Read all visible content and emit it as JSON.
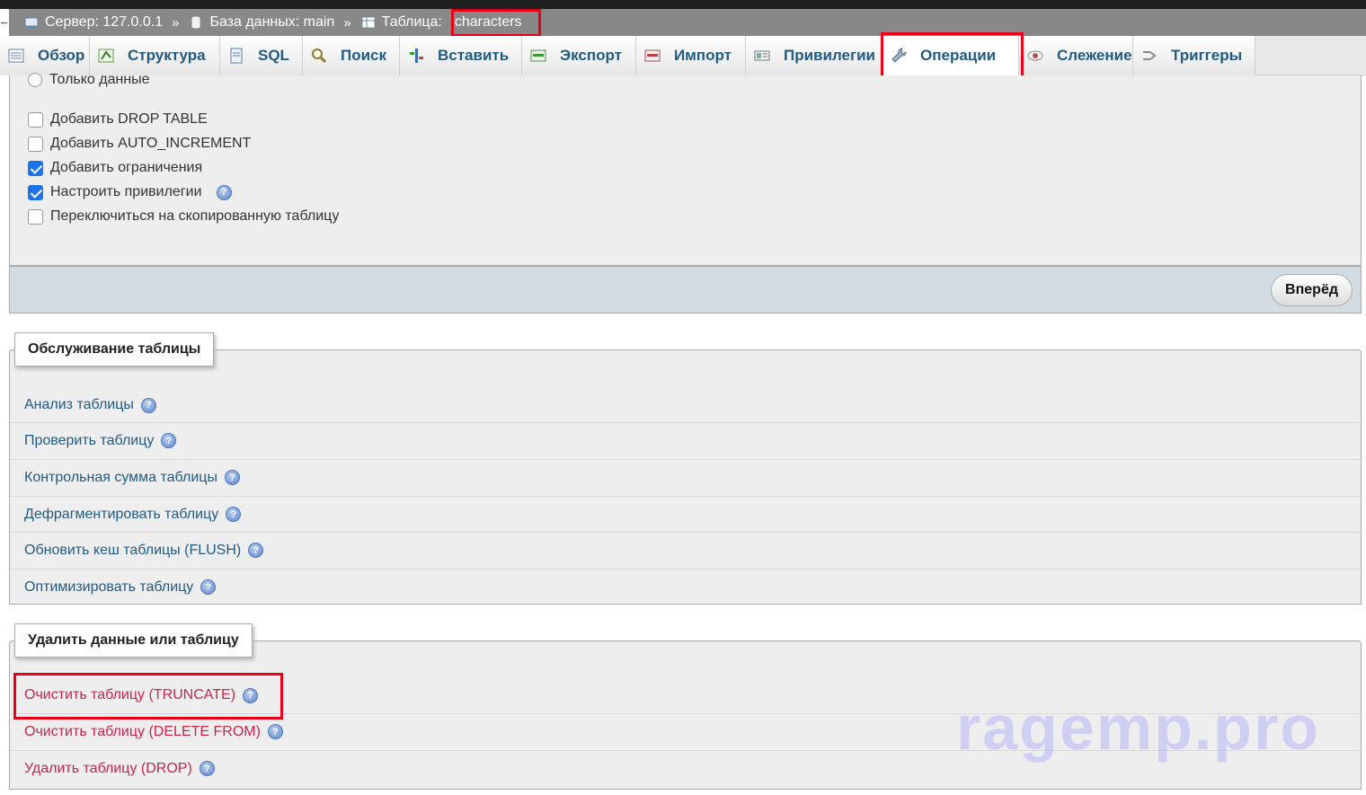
{
  "breadcrumb": {
    "server": "Сервер: 127.0.0.1",
    "database": "База данных: main",
    "table_label": "Таблица:",
    "table_name": "characters",
    "separator": "»"
  },
  "tabs": [
    {
      "label": "Обзор",
      "icon": "browse-icon"
    },
    {
      "label": "Структура",
      "icon": "structure-icon"
    },
    {
      "label": "SQL",
      "icon": "sql-icon"
    },
    {
      "label": "Поиск",
      "icon": "search-icon"
    },
    {
      "label": "Вставить",
      "icon": "insert-icon"
    },
    {
      "label": "Экспорт",
      "icon": "export-icon"
    },
    {
      "label": "Импорт",
      "icon": "import-icon"
    },
    {
      "label": "Привилегии",
      "icon": "privileges-icon"
    },
    {
      "label": "Операции",
      "icon": "wrench-icon",
      "active": true
    },
    {
      "label": "Слежение",
      "icon": "eye-icon"
    },
    {
      "label": "Триггеры",
      "icon": "triggers-icon"
    }
  ],
  "copy_options": {
    "radio_data_only": "Только данные",
    "checkboxes": [
      {
        "label": "Добавить DROP TABLE",
        "checked": false
      },
      {
        "label": "Добавить AUTO_INCREMENT",
        "checked": false
      },
      {
        "label": "Добавить ограничения",
        "checked": true
      },
      {
        "label": "Настроить привилегии",
        "checked": true,
        "help": true
      },
      {
        "label": "Переключиться на скопированную таблицу",
        "checked": false
      }
    ],
    "submit_label": "Вперёд"
  },
  "maintenance": {
    "title": "Обслуживание таблицы",
    "items": [
      "Анализ таблицы",
      "Проверить таблицу",
      "Контрольная сумма таблицы",
      "Дефрагментировать таблицу",
      "Обновить кеш таблицы (FLUSH)",
      "Оптимизировать таблицу"
    ]
  },
  "delete": {
    "title": "Удалить данные или таблицу",
    "items": [
      "Очистить таблицу (TRUNCATE)",
      "Очистить таблицу (DELETE FROM)",
      "Удалить таблицу (DROP)"
    ]
  },
  "watermark": "ragemp.pro",
  "colors": {
    "link": "#235a81",
    "danger": "#c7254e",
    "highlight": "#e8001a"
  }
}
